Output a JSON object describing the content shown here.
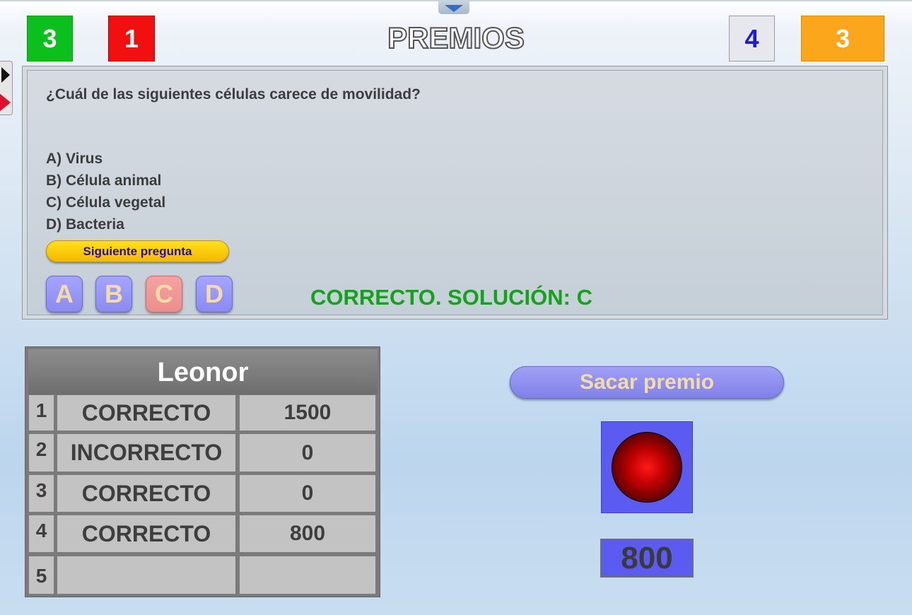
{
  "header": {
    "title": "PREMIOS",
    "scores": [
      "3",
      "1",
      "4",
      "3"
    ],
    "score_colors": [
      "#0bbf1c",
      "#f20f0f",
      "#e7e7ee",
      "#fba61b"
    ]
  },
  "question": {
    "text": "¿Cuál de las siguientes células carece de movilidad?",
    "options": [
      "A) Virus",
      "B) Célula animal",
      "C) Célula vegetal",
      "D) Bacteria"
    ],
    "next_label": "Siguiente pregunta",
    "answer_buttons": [
      "A",
      "B",
      "C",
      "D"
    ],
    "selected_answer": "C",
    "result": "CORRECTO. SOLUCIÓN: C"
  },
  "player": {
    "name": "Leonor",
    "rows": [
      {
        "num": "1",
        "status": "CORRECTO",
        "points": "1500"
      },
      {
        "num": "2",
        "status": "INCORRECTO",
        "points": "0"
      },
      {
        "num": "3",
        "status": "CORRECTO",
        "points": "0"
      },
      {
        "num": "4",
        "status": "CORRECTO",
        "points": "800"
      },
      {
        "num": "5",
        "status": "",
        "points": ""
      }
    ]
  },
  "prize": {
    "button_label": "Sacar premio",
    "value": "800"
  }
}
